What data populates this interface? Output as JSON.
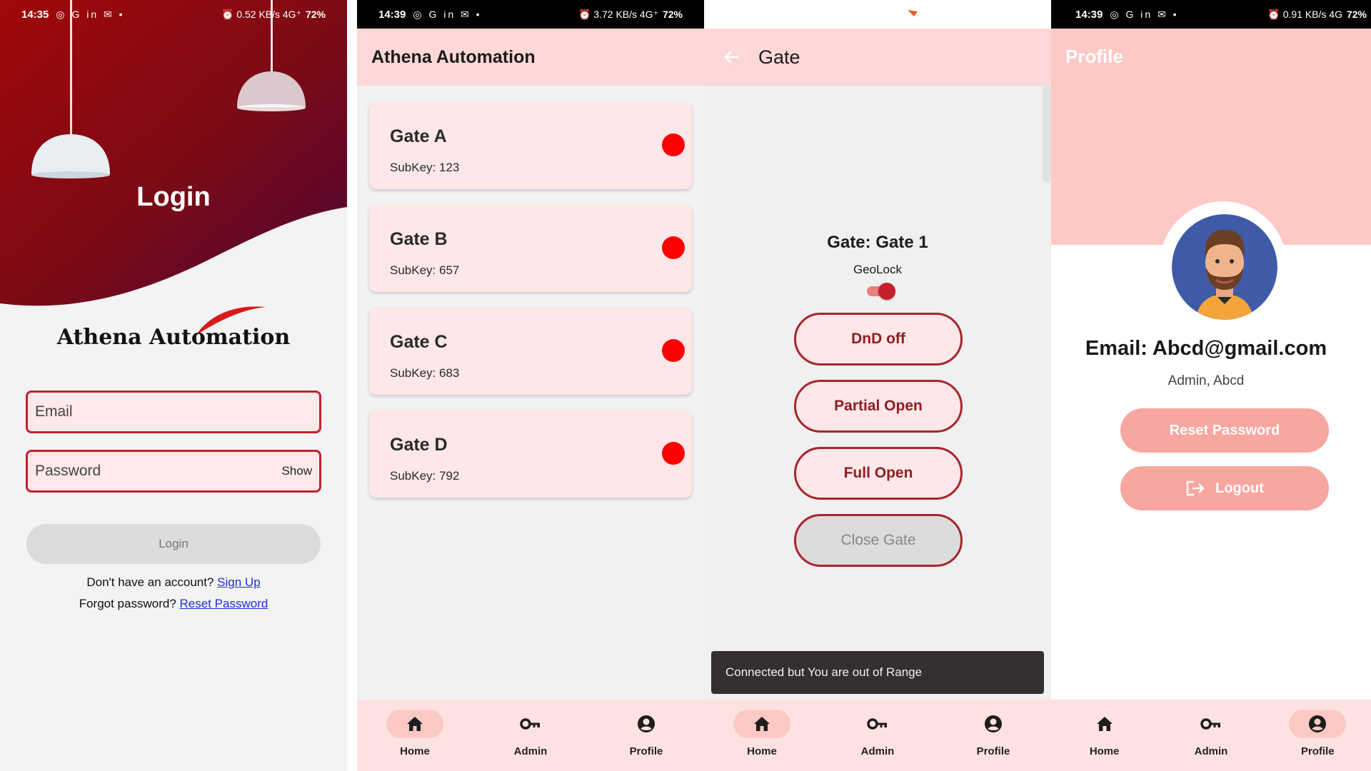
{
  "login": {
    "status": {
      "time": "14:35",
      "icons": "◎ G in ✉ •",
      "right": "⏰ 0.52 KB/s 4G⁺",
      "battery": "72%"
    },
    "title": "Login",
    "brand": "Athena Automation",
    "email_placeholder": "Email",
    "password_placeholder": "Password",
    "show_label": "Show",
    "login_button": "Login",
    "signup_prompt": "Don't have an account?",
    "signup_link": "Sign Up",
    "forgot_prompt": "Forgot password?",
    "reset_link": "Reset Password"
  },
  "gates": {
    "status": {
      "time": "14:39",
      "icons": "◎ G in ✉ •",
      "right": "⏰ 3.72 KB/s 4G⁺",
      "battery": "72%"
    },
    "app_title": "Athena Automation",
    "items": [
      {
        "name": "Gate A",
        "subkey": "SubKey: 123"
      },
      {
        "name": "Gate B",
        "subkey": "SubKey: 657"
      },
      {
        "name": "Gate C",
        "subkey": "SubKey: 683"
      },
      {
        "name": "Gate D",
        "subkey": "SubKey: 792"
      }
    ],
    "status_color": "#ff0000"
  },
  "gate_detail": {
    "title": "Gate",
    "gate_name": "Gate: Gate 1",
    "geolock_label": "GeoLock",
    "geolock_on": true,
    "buttons": {
      "dnd": "DnD off",
      "partial": "Partial Open",
      "full": "Full Open",
      "close": "Close Gate"
    },
    "snackbar": "Connected but You are out of Range"
  },
  "profile": {
    "status": {
      "time": "14:39",
      "icons": "◎ G in ✉ •",
      "right": "⏰ 0.91 KB/s 4G",
      "battery": "72%"
    },
    "title": "Profile",
    "email": "Email: Abcd@gmail.com",
    "role": "Admin, Abcd",
    "reset_button": "Reset Password",
    "logout_button": "Logout"
  },
  "nav": {
    "home": "Home",
    "admin": "Admin",
    "profile": "Profile"
  },
  "colors": {
    "accent": "#c6202a",
    "appbar": "#fdd8d6",
    "nav_active": "#fbc9c4",
    "profile_button": "#f8a6a0"
  }
}
